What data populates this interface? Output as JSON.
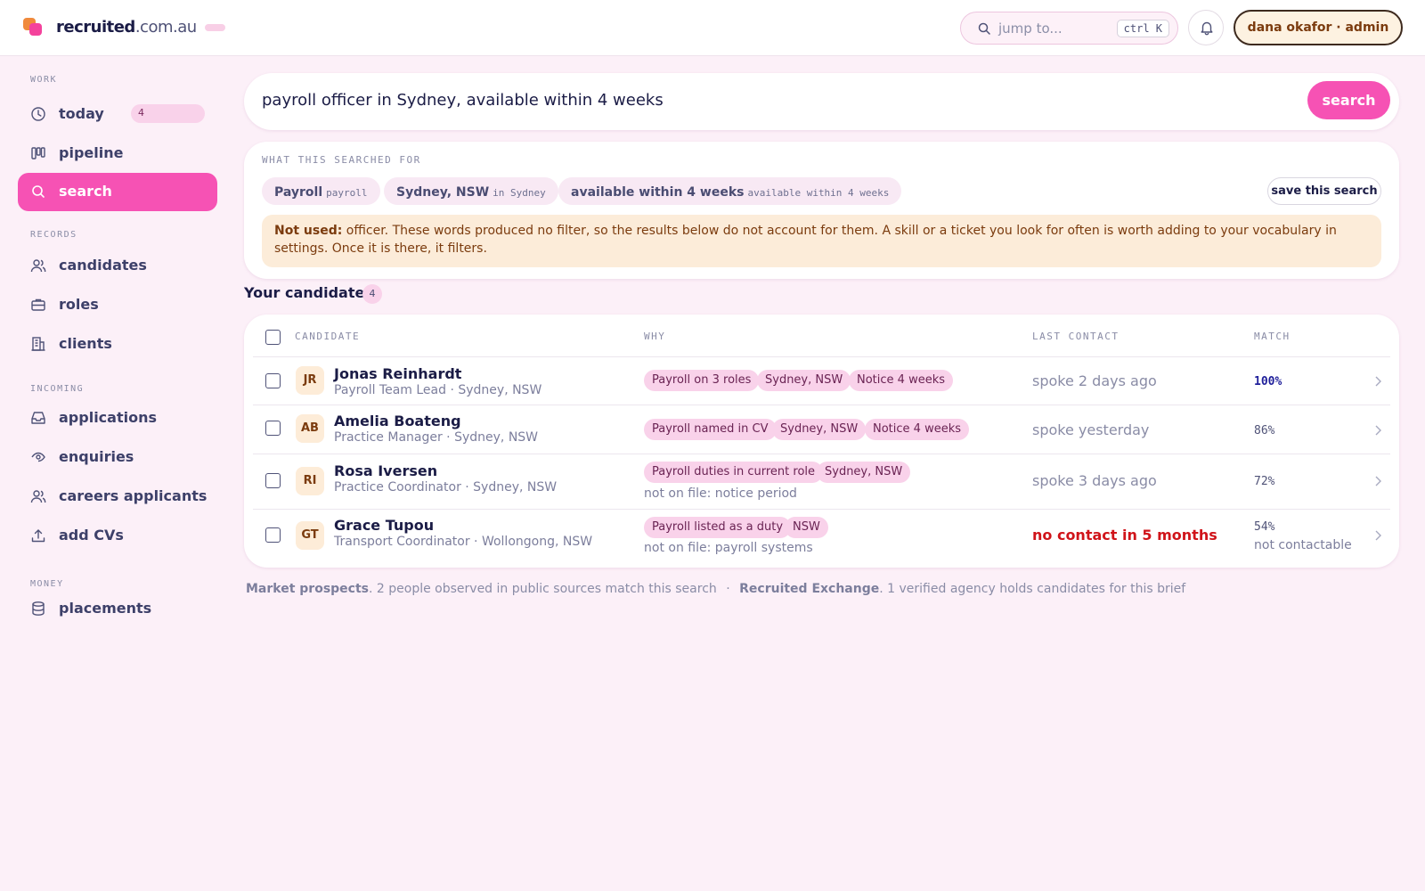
{
  "brand": {
    "name_bold": "recruited",
    "name_rest": ".com.au"
  },
  "topbar": {
    "jump_placeholder": "jump to...",
    "jump_shortcut": "ctrl K",
    "user_label": "dana okafor · admin"
  },
  "sidebar": {
    "sections": {
      "work": "WORK",
      "records": "RECORDS",
      "incoming": "INCOMING",
      "money": "MONEY"
    },
    "items": {
      "today": {
        "label": "today",
        "badge": "4",
        "icon": "clock-icon"
      },
      "pipeline": {
        "label": "pipeline",
        "icon": "kanban-icon"
      },
      "search": {
        "label": "search",
        "icon": "search-icon",
        "active": true
      },
      "candidates": {
        "label": "candidates",
        "icon": "users-icon"
      },
      "roles": {
        "label": "roles",
        "icon": "briefcase-icon"
      },
      "clients": {
        "label": "clients",
        "icon": "building-icon"
      },
      "applications": {
        "label": "applications",
        "icon": "inbox-icon"
      },
      "enquiries": {
        "label": "enquiries",
        "icon": "enquiry-icon"
      },
      "careers_applicants": {
        "label": "careers applicants",
        "icon": "users-icon"
      },
      "add_cvs": {
        "label": "add CVs",
        "icon": "upload-icon"
      },
      "placements": {
        "label": "placements",
        "icon": "database-icon"
      }
    }
  },
  "search": {
    "query": "payroll officer in Sydney, available within 4 weeks",
    "button": "search"
  },
  "interpretation": {
    "title": "WHAT THIS SEARCHED FOR",
    "chips": [
      {
        "value": "Payroll",
        "source": "payroll"
      },
      {
        "value": "Sydney, NSW",
        "source": "in Sydney"
      },
      {
        "value": "available within 4 weeks",
        "source": "available within 4 weeks"
      }
    ],
    "save_button": "save this search",
    "not_used_label": "Not used:",
    "not_used_text": "officer. These words produced no filter, so the results below do not account for them. A skill or a ticket you look for often is worth adding to your vocabulary in settings. Once it is there, it filters."
  },
  "candidates": {
    "title": "Your candidates",
    "count": "4",
    "columns": [
      "CANDIDATE",
      "WHY",
      "LAST CONTACT",
      "MATCH"
    ],
    "rows": [
      {
        "initials": "JR",
        "name": "Jonas Reinhardt",
        "subtitle": "Payroll Team Lead · Sydney, NSW",
        "tags": [
          "Payroll on 3 roles",
          "Sydney, NSW",
          "Notice 4 weeks"
        ],
        "not_on_file": "",
        "last_contact": "spoke 2 days ago",
        "contact_warning": false,
        "match": "100%",
        "match_pct": 100,
        "match_note": ""
      },
      {
        "initials": "AB",
        "name": "Amelia Boateng",
        "subtitle": "Practice Manager · Sydney, NSW",
        "tags": [
          "Payroll named in CV",
          "Sydney, NSW",
          "Notice 4 weeks"
        ],
        "not_on_file": "",
        "last_contact": "spoke yesterday",
        "contact_warning": false,
        "match": "86%",
        "match_pct": 86,
        "match_note": ""
      },
      {
        "initials": "RI",
        "name": "Rosa Iversen",
        "subtitle": "Practice Coordinator · Sydney, NSW",
        "tags": [
          "Payroll duties in current role",
          "Sydney, NSW"
        ],
        "not_on_file": "not on file: notice period",
        "last_contact": "spoke 3 days ago",
        "contact_warning": false,
        "match": "72%",
        "match_pct": 72,
        "match_note": ""
      },
      {
        "initials": "GT",
        "name": "Grace Tupou",
        "subtitle": "Transport Coordinator · Wollongong, NSW",
        "tags": [
          "Payroll listed as a duty",
          "NSW"
        ],
        "not_on_file": "not on file: payroll systems",
        "last_contact": "no contact in 5 months",
        "contact_warning": true,
        "match": "54%",
        "match_pct": 54,
        "match_note": "not contactable"
      }
    ]
  },
  "footer": {
    "market_label": "Market prospects",
    "market_text": ". 2 people observed in public sources match this search",
    "separator": "·",
    "exchange_label": "Recruited Exchange",
    "exchange_text": ". 1 verified agency holds candidates for this brief"
  },
  "colors": {
    "accent": "#f652b4",
    "background": "#fcf0f8",
    "warning": "#d0141a",
    "notice_bg": "#fcecd9"
  }
}
